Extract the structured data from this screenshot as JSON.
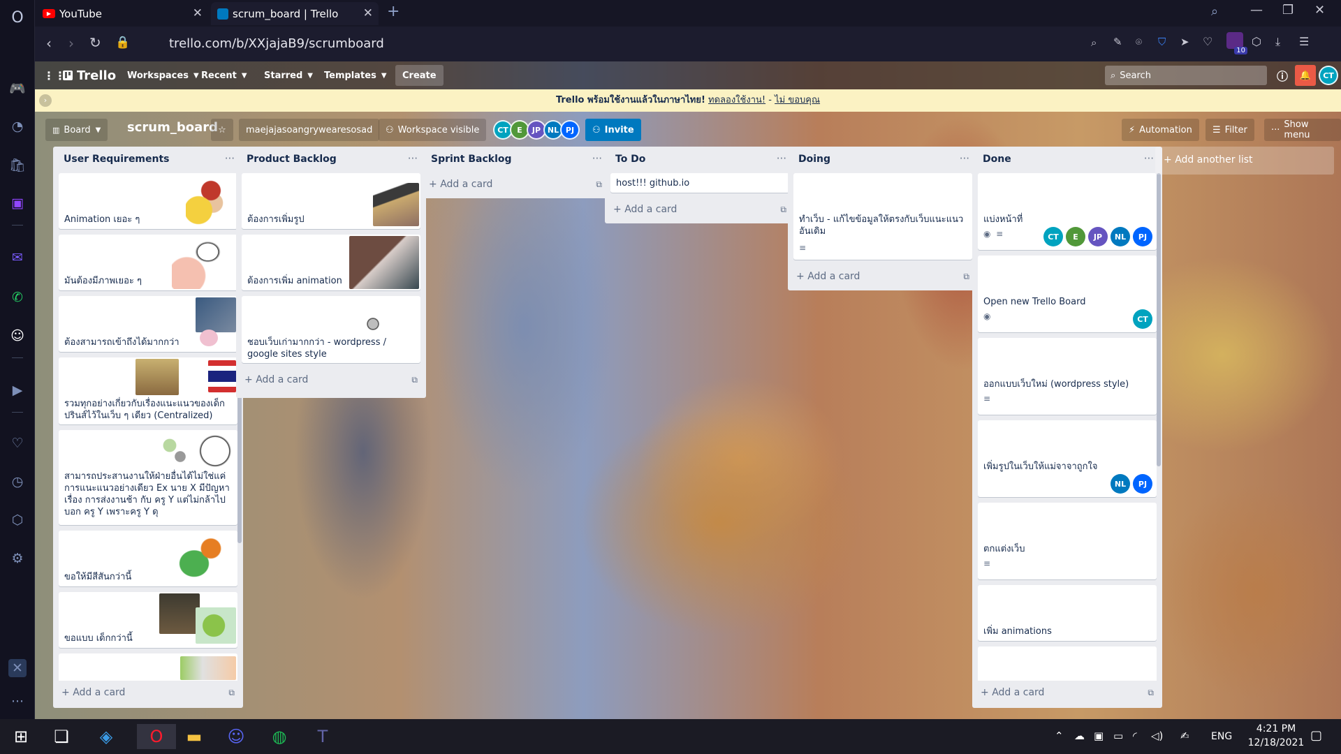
{
  "browser": {
    "tabs": [
      {
        "title": "YouTube",
        "favicon": "youtube-icon"
      },
      {
        "title": "scrum_board | Trello",
        "favicon": "trello-icon"
      }
    ],
    "url": "trello.com/b/XXjajaB9/scrumboard",
    "download_count": "10",
    "profile_initials": "CT"
  },
  "trello": {
    "logo": "Trello",
    "nav": [
      "Workspaces",
      "Recent",
      "Starred",
      "Templates"
    ],
    "create_label": "Create",
    "search_placeholder": "Search",
    "banner": {
      "text": "Trello พร้อมใช้งานแล้วในภาษาไทย!",
      "try_link": "ทดลองใช้งาน!",
      "sep": "-",
      "decline_link": "ไม่ ขอบคุณ"
    }
  },
  "board": {
    "view": "Board",
    "name": "scrum_board",
    "workspace": "maejajasoangrywearesosad",
    "visibility": "Workspace visible",
    "members": [
      {
        "initials": "CT",
        "color": "#00a3bf"
      },
      {
        "initials": "E",
        "color": "#519839"
      },
      {
        "initials": "JP",
        "color": "#6554c0"
      },
      {
        "initials": "NL",
        "color": "#0079bf"
      },
      {
        "initials": "PJ",
        "color": "#0065ff"
      }
    ],
    "invite": "Invite",
    "automation": "Automation",
    "filter": "Filter",
    "show_menu": "Show menu",
    "add_list": "Add another list",
    "add_card": "Add a card"
  },
  "lists": [
    {
      "title": "User Requirements",
      "cards": [
        {
          "text": "Animation เยอะ ๆ"
        },
        {
          "text": "มันต้องมีภาพเยอะ ๆ"
        },
        {
          "text": "ต้องสามารถเข้าถึงได้มากกว่า"
        },
        {
          "text": "รวมทุกอย่างเกี่ยวกับเรื่องแนะแนวของเด็กปรินส์ไว้ในเว็บ ๆ เดียว (Centralized)"
        },
        {
          "text": "สามารถประสานงานให้ฝ่ายอื่นได้ไม่ใช่แค่การแนะแนวอย่างเดียว Ex นาย X มีปัญหาเรื่อง การส่งงานช้า กับ ครู Y แต่ไม่กล้าไปบอก ครู Y เพราะครู Y ดุ"
        },
        {
          "text": "ขอให้มีสีสันกว่านี้"
        },
        {
          "text": "ขอแบบ เด็กกว่านี้"
        },
        {
          "text": ""
        }
      ]
    },
    {
      "title": "Product Backlog",
      "cards": [
        {
          "text": "ต้องการเพิ่มรูป"
        },
        {
          "text": "ต้องการเพิ่ม animation"
        },
        {
          "text": "ชอบเว็บเก่ามากกว่า - wordpress / google sites style"
        }
      ]
    },
    {
      "title": "Sprint Backlog",
      "cards": []
    },
    {
      "title": "To Do",
      "cards": [
        {
          "text": "host!!! github.io"
        }
      ]
    },
    {
      "title": "Doing",
      "cards": [
        {
          "text": "ทำเว็บ - แก้ไขข้อมูลให้ตรงกับเว็บแนะแนวอันเดิม"
        }
      ]
    },
    {
      "title": "Done",
      "cards": [
        {
          "text": "แบ่งหน้าที่",
          "members": [
            "CT",
            "E",
            "JP",
            "NL",
            "PJ"
          ]
        },
        {
          "text": "Open new Trello Board",
          "members": [
            "CT"
          ]
        },
        {
          "text": "ออกแบบเว็บใหม่ (wordpress style)"
        },
        {
          "text": "เพิ่มรูปในเว็บให้แม่จาจาถูกใจ",
          "members": [
            "NL",
            "PJ"
          ]
        },
        {
          "text": "ตกแต่งเว็บ"
        },
        {
          "text": "เพิ่ม animations"
        },
        {
          "text": ""
        }
      ]
    }
  ],
  "taskbar": {
    "language": "ENG",
    "time": "4:21 PM",
    "date": "12/18/2021"
  }
}
